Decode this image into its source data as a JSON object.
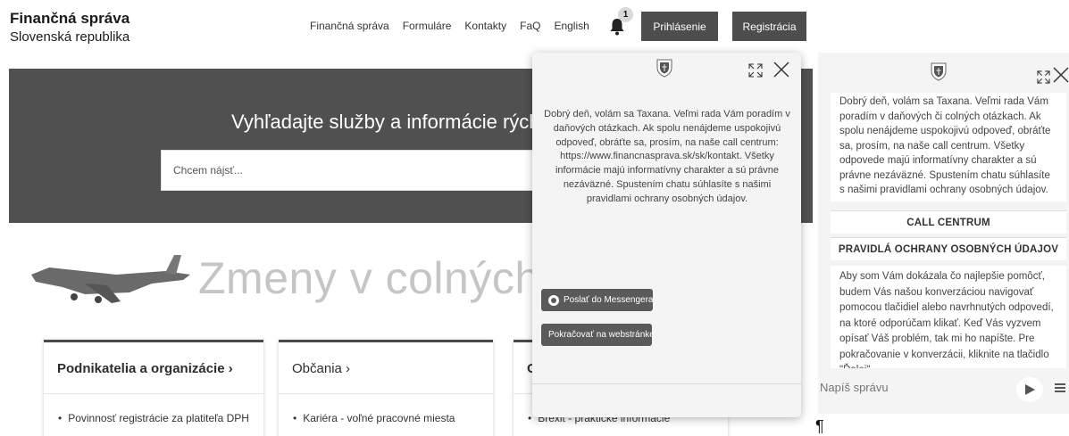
{
  "header": {
    "brand_title": "Finančná správa",
    "brand_subtitle": "Slovenská republika",
    "nav": [
      "Finančná správa",
      "Formuláre",
      "Kontakty",
      "FaQ",
      "English"
    ],
    "notification_count": "1",
    "login_label": "Prihlásenie",
    "register_label": "Registrácia"
  },
  "hero": {
    "title": "Vyhľadajte služby a informácie rých",
    "search_placeholder": "Chcem nájsť..."
  },
  "banner": {
    "text": "Zmeny v colných s"
  },
  "cards": [
    {
      "title": "Podnikatelia a organizácie ›",
      "item": "Povinnosť registrácie za platiteľa DPH"
    },
    {
      "title": "Občania ›",
      "item": "Kariéra - voľné pracovné miesta"
    },
    {
      "title": "O",
      "item": "Brexit - praktické informácie"
    }
  ],
  "chat_popup": {
    "message": "Dobrý deň, volám sa Taxana. Veľmi rada Vám poradím v daňových otázkach. Ak spolu nenájdeme uspokojivú odpoveď, obráťte sa, prosím, na naše call centrum: https://www.financnasprava.sk/sk/kontakt. Všetky informácie majú informatívny charakter a sú právne nezáväzné. Spustením chatu súhlasíte s našimi pravidlami ochrany osobných údajov.",
    "messenger_button": "Poslať do Messengera",
    "web_button": "Pokračovať na webstránke"
  },
  "chat_panel": {
    "message": "Dobrý deň, volám sa Taxana. Veľmi rada Vám poradím v daňových či colných otázkach. Ak spolu nenájdeme uspokojivú odpoveď, obráťte sa, prosím, na naše call centrum. Všetky odpovede majú informatívny charakter a sú právne nezáväzné. Spustením chatu súhlasíte s našimi pravidlami ochrany osobných údajov.",
    "call_center_button": "CALL CENTRUM",
    "privacy_button": "PRAVIDLÁ OCHRANY OSOBNÝCH ÚDAJOV",
    "message2": "Aby som Vám dokázala čo najlepšie pomôcť, budem Vás našou konverzáciou navigovať pomocou tlačidiel alebo navrhnutých odpovedí, na ktoré odporúčam klikať. Keď Vás vyzvem opísať Váš problém, tak mi ho napíšte. Pre pokračovanie v konverzácii, kliknite na tlačidlo \"Ďalej\".",
    "input_placeholder": "Napíš správu"
  },
  "pilcrow": "¶"
}
